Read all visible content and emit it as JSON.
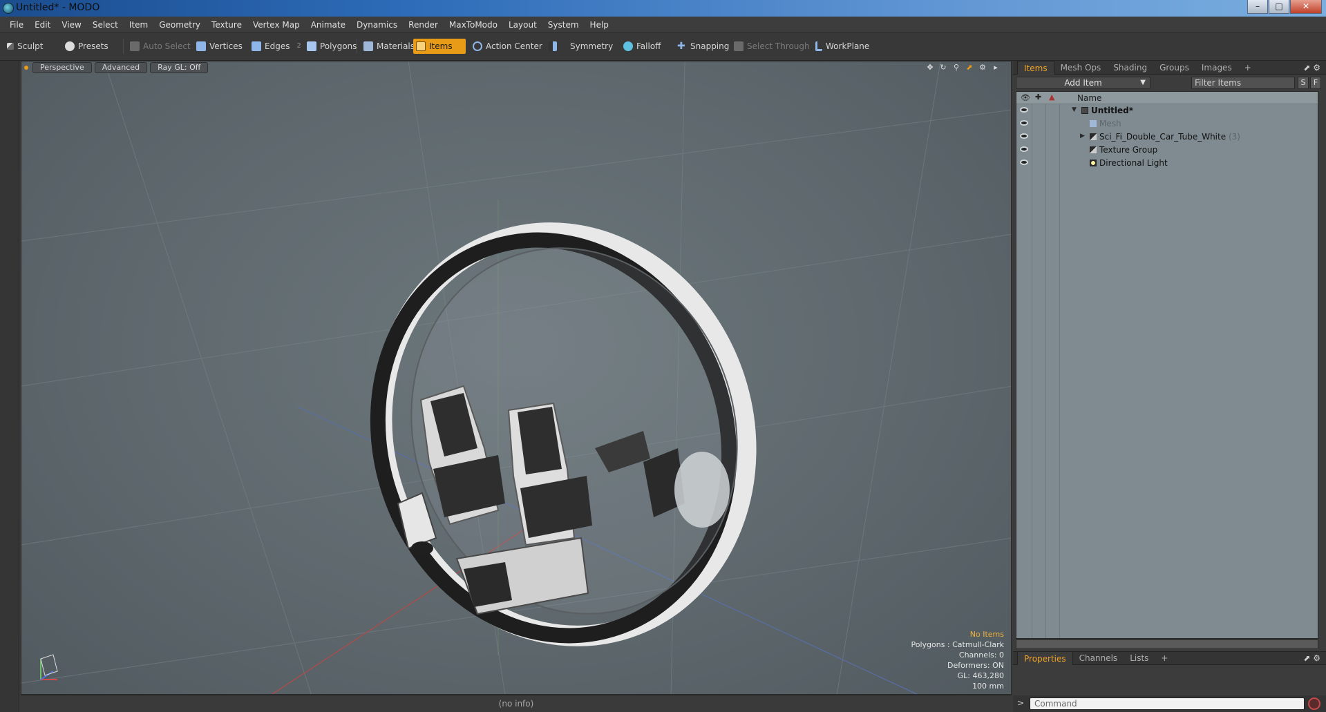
{
  "window": {
    "title": "Untitled* - MODO"
  },
  "menu": [
    "File",
    "Edit",
    "View",
    "Select",
    "Item",
    "Geometry",
    "Texture",
    "Vertex Map",
    "Animate",
    "Dynamics",
    "Render",
    "MaxToModo",
    "Layout",
    "System",
    "Help"
  ],
  "toolbar": {
    "sculpt": "Sculpt",
    "presets": "Presets",
    "auto_select": "Auto Select",
    "vertices": "Vertices",
    "edges": "Edges",
    "edges_count": "2",
    "polygons": "Polygons",
    "materials": "Materials",
    "items": "Items",
    "action_center": "Action Center",
    "symmetry": "Symmetry",
    "falloff": "Falloff",
    "snapping": "Snapping",
    "select_through": "Select Through",
    "workplane": "WorkPlane"
  },
  "viewport": {
    "tabs": [
      "Perspective",
      "Advanced",
      "Ray GL: Off"
    ],
    "info": {
      "selection": "No Items",
      "polygons": "Polygons : Catmull-Clark",
      "channels": "Channels: 0",
      "deformers": "Deformers: ON",
      "gl": "GL: 463,280",
      "unit": "100 mm"
    }
  },
  "status": {
    "info": "(no info)"
  },
  "panel": {
    "tabs": [
      "Items",
      "Mesh Ops",
      "Shading",
      "Groups",
      "Images"
    ],
    "add_item": "Add Item",
    "filter_placeholder": "Filter Items",
    "s_btn": "S",
    "f_btn": "F",
    "column_name": "Name",
    "tree": [
      {
        "label": "Untitled*",
        "count": ""
      },
      {
        "label": "Mesh",
        "count": ""
      },
      {
        "label": "Sci_Fi_Double_Car_Tube_White",
        "count": "(3)"
      },
      {
        "label": "Texture Group",
        "count": ""
      },
      {
        "label": "Directional Light",
        "count": ""
      }
    ],
    "bottom_tabs": [
      "Properties",
      "Channels",
      "Lists"
    ],
    "command_placeholder": "Command"
  },
  "colors": {
    "accent": "#e89b16",
    "viewport_bg": "#5e686d",
    "tree_bg": "#7f8b90"
  }
}
